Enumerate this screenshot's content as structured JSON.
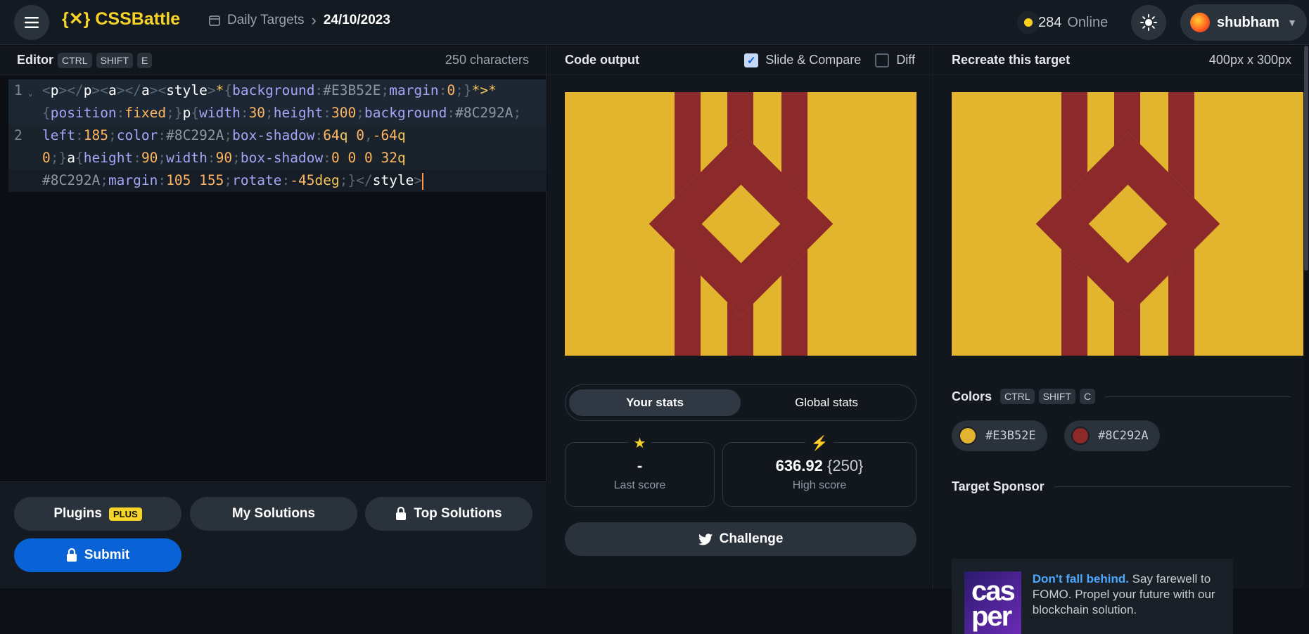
{
  "header": {
    "brand": "{✕} CSSBattle",
    "breadcrumb": "Daily Targets",
    "date": "24/10/2023",
    "online_count": "284",
    "online_label": "Online",
    "username": "shubham"
  },
  "editor": {
    "title": "Editor",
    "shortcut": [
      "CTRL",
      "SHIFT",
      "E"
    ],
    "char_count": "250 characters",
    "line_numbers": [
      "1",
      "2"
    ]
  },
  "bottom": {
    "plugins": "Plugins",
    "plugins_badge": "PLUS",
    "my_solutions": "My Solutions",
    "top_solutions": "Top Solutions",
    "submit": "Submit"
  },
  "output": {
    "title": "Code output",
    "slide_compare": "Slide & Compare",
    "diff": "Diff",
    "stats_tabs": [
      "Your stats",
      "Global stats"
    ],
    "last_score_value": "-",
    "last_score_label": "Last score",
    "high_score_value": "636.92",
    "high_score_chars": "{250}",
    "high_score_label": "High score",
    "challenge": "Challenge"
  },
  "target": {
    "title": "Recreate this target",
    "size": "400px x 300px",
    "colors_title": "Colors",
    "colors_shortcut": [
      "CTRL",
      "SHIFT",
      "C"
    ],
    "colors": [
      {
        "hex": "#E3B52E"
      },
      {
        "hex": "#8C292A"
      }
    ],
    "sponsor_title": "Target Sponsor",
    "sponsor_image_text": "cas per",
    "sponsor_headline": "Don't fall behind.",
    "sponsor_body": " Say farewell to FOMO. Propel your future with our blockchain solution."
  },
  "colors": {
    "accent": "#f5d328",
    "submit": "#0a63d6",
    "target_bg": "#E3B52E",
    "target_fg": "#8C292A"
  }
}
